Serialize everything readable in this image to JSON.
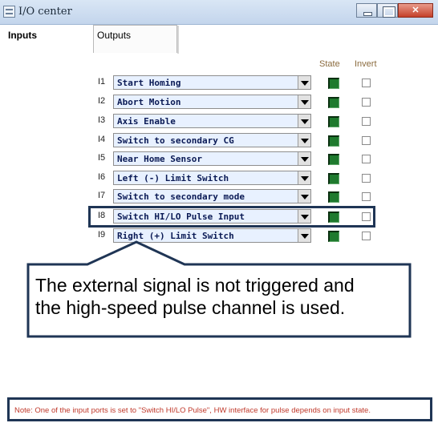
{
  "window": {
    "title": "I/O center"
  },
  "tabs": [
    {
      "label": "Inputs"
    },
    {
      "label": "Outputs"
    }
  ],
  "columns": {
    "state": "State",
    "invert": "Invert"
  },
  "inputs": [
    {
      "pin": "I1",
      "value": "Start Homing",
      "state_on": true,
      "invert": false
    },
    {
      "pin": "I2",
      "value": "Abort Motion",
      "state_on": true,
      "invert": false
    },
    {
      "pin": "I3",
      "value": "Axis Enable",
      "state_on": true,
      "invert": false
    },
    {
      "pin": "I4",
      "value": "Switch to secondary CG",
      "state_on": true,
      "invert": false
    },
    {
      "pin": "I5",
      "value": "Near Home Sensor",
      "state_on": true,
      "invert": false
    },
    {
      "pin": "I6",
      "value": "Left (-) Limit Switch",
      "state_on": true,
      "invert": false
    },
    {
      "pin": "I7",
      "value": "Switch to secondary mode",
      "state_on": true,
      "invert": false
    },
    {
      "pin": "I8",
      "value": "Switch HI/LO Pulse Input",
      "state_on": true,
      "invert": false
    },
    {
      "pin": "I9",
      "value": "Right (+) Limit Switch",
      "state_on": true,
      "invert": false
    }
  ],
  "callout": {
    "line1": "The external signal is not triggered and",
    "line2": "the high-speed pulse channel is used."
  },
  "note": "Note: One of the input ports is set to \"Switch HI/LO Pulse\", HW interface for pulse depends on input state.",
  "colors": {
    "led_on": "#1f7a2e",
    "select_bg": "#e8f1ff",
    "annotation": "#1f3555",
    "note_text": "#c0392b",
    "header_text": "#8b6b3e"
  }
}
